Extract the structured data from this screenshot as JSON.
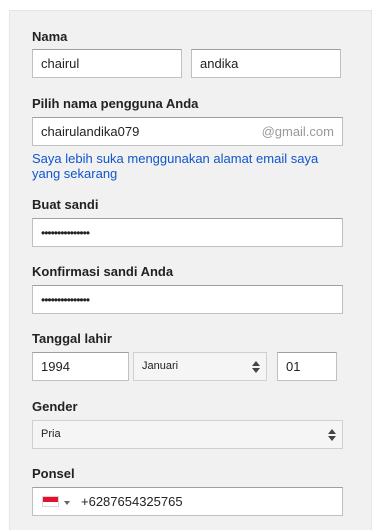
{
  "form": {
    "name": {
      "label": "Nama",
      "first_value": "chairul",
      "last_value": "andika"
    },
    "username": {
      "label": "Pilih nama pengguna Anda",
      "value": "chairulandika079",
      "suffix": "@gmail.com",
      "link_text": "Saya lebih suka menggunakan alamat email saya yang sekarang"
    },
    "password": {
      "label": "Buat sandi",
      "masked_value": "•••••••••••••••"
    },
    "confirm_password": {
      "label": "Konfirmasi sandi Anda",
      "masked_value": "•••••••••••••••"
    },
    "birthdate": {
      "label": "Tanggal lahir",
      "year_value": "1994",
      "month_selected": "Januari",
      "day_value": "01"
    },
    "gender": {
      "label": "Gender",
      "selected": "Pria"
    },
    "phone": {
      "label": "Ponsel",
      "value": "+6287654325765",
      "flag_icon": "indonesia-flag-icon"
    }
  },
  "colors": {
    "link": "#1155cc",
    "panel_bg": "#f1f1f1",
    "flag_red": "#e8112d"
  }
}
